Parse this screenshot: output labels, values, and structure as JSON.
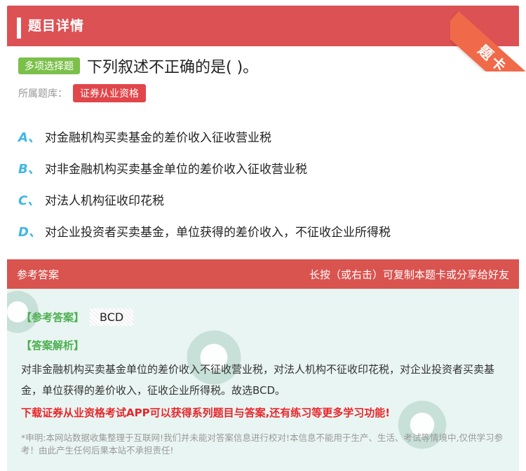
{
  "header": {
    "title": "题目详情",
    "corner_label": "题卡"
  },
  "question": {
    "type_tag": "多项选择题",
    "text": "下列叙述不正确的是( )。",
    "bank_label": "所属题库：",
    "bank_name": "证券从业资格"
  },
  "options": [
    {
      "letter": "A、",
      "text": "对金融机构买卖基金的差价收入征收营业税"
    },
    {
      "letter": "B、",
      "text": "对非金融机构买卖基金单位的差价收入征收营业税"
    },
    {
      "letter": "C、",
      "text": "对法人机构征收印花税"
    },
    {
      "letter": "D、",
      "text": "对企业投资者买卖基金，单位获得的差价收入，不征收企业所得税"
    }
  ],
  "answer": {
    "section_title": "参考答案",
    "tip": "长按（或右击）可复制本题卡或分享给好友",
    "ref_label": "【参考答案】",
    "ref_value": "BCD",
    "analysis_label": "【答案解析】",
    "analysis_text": "对非金融机构买卖基金单位的差价收入不征收营业税，对法人机构不征收印花税，对企业投资者买卖基金，单位获得的差价收入，征收企业所得税。故选BCD。",
    "promo": "下载证券从业资格考试APP可以获得系列题目与答案,还有练习等更多学习功能!",
    "disclaimer": "*申明:本网站数据收集整理于互联网!我们并未能对答案信息进行校对!本信息不能用于生产、生活、考试等情境中,仅供学习参考！由此产生任何后果本站不承担责任!"
  },
  "colors": {
    "header": "#dc5154",
    "tag_green": "#7cc04b",
    "tag_red": "#e0464a",
    "option_letter": "#3fb6e6",
    "promo": "#e8262b"
  }
}
